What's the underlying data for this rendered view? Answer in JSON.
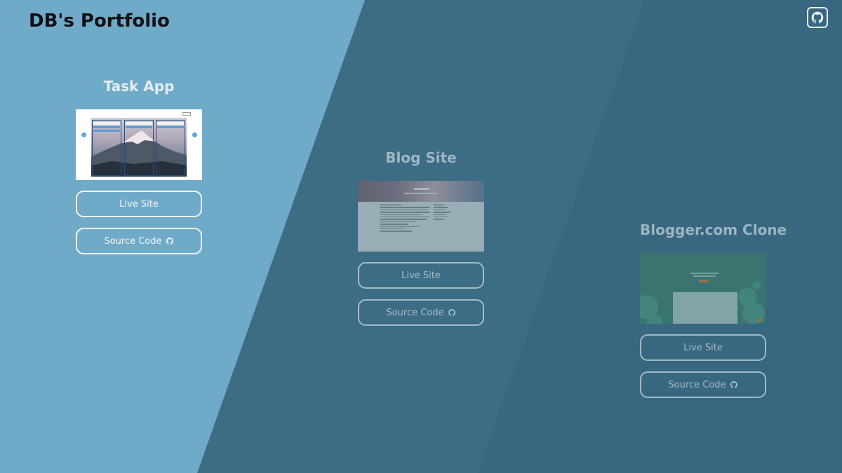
{
  "site": {
    "title": "DB's Portfolio"
  },
  "header": {
    "github_icon": "github-icon"
  },
  "projects": [
    {
      "title": "Task App",
      "live_label": "Live Site",
      "source_label": "Source Code"
    },
    {
      "title": "Blog Site",
      "live_label": "Live Site",
      "source_label": "Source Code"
    },
    {
      "title": "Blogger.com Clone",
      "live_label": "Live Site",
      "source_label": "Source Code"
    }
  ],
  "colors": {
    "panel_1": "#6faac9",
    "panel_2": "#3d6c85",
    "panel_3": "#386780",
    "button_border": "#f1f4f6",
    "title_text": "#0e1114"
  }
}
